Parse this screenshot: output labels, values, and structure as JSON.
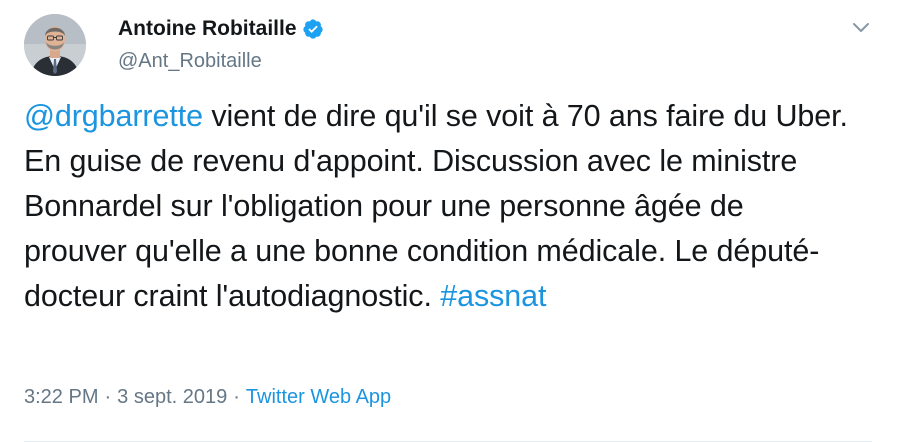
{
  "author": {
    "display_name": "Antoine Robitaille",
    "handle": "@Ant_Robitaille",
    "verified": true
  },
  "tweet": {
    "mention": "@drgbarrette",
    "text": " vient de dire qu'il se voit à 70 ans faire du Uber. En guise de revenu d'appoint. Discussion avec le ministre Bonnardel sur l'obligation pour une personne âgée de prouver qu'elle a une bonne condition médicale. Le député-docteur craint l'autodiagnostic. ",
    "hashtag": "#assnat"
  },
  "meta": {
    "time": "3:22 PM",
    "separator": "·",
    "date": "3 sept. 2019",
    "source": "Twitter Web App"
  },
  "icons": {
    "verified": "verified-badge-icon",
    "menu": "chevron-down-icon"
  },
  "colors": {
    "link": "#1b95e0",
    "secondary_text": "#657786",
    "primary_text": "#14171a",
    "verified": "#1da1f2"
  }
}
